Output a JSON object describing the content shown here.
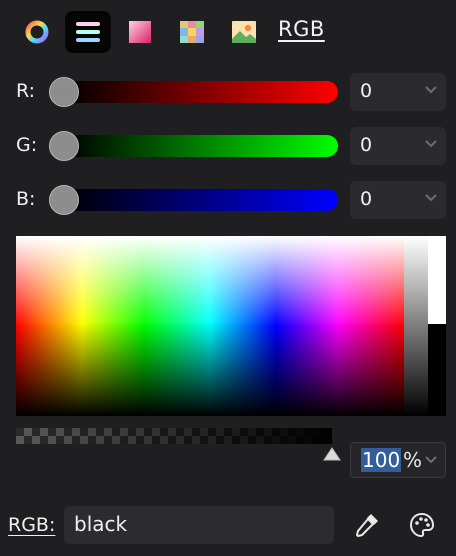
{
  "toolbar": {
    "tabs": [
      {
        "name": "color-wheel",
        "active": false
      },
      {
        "name": "sliders",
        "active": true
      },
      {
        "name": "color-palettes",
        "active": false
      },
      {
        "name": "color-swatches",
        "active": false
      },
      {
        "name": "image-colors",
        "active": false
      }
    ],
    "mode_label": "RGB"
  },
  "channels": [
    {
      "label": "R:",
      "value": "0",
      "color": "#ff0000"
    },
    {
      "label": "G:",
      "value": "0",
      "color": "#00ff00"
    },
    {
      "label": "B:",
      "value": "0",
      "color": "#0000ff"
    }
  ],
  "alpha": {
    "value": "100",
    "unit": "%"
  },
  "color_name": {
    "label": "RGB:",
    "value": "black"
  },
  "colors": {
    "background": "#1f1f21",
    "spin_box": "#2b2b2e",
    "selection": "#335e9a"
  },
  "icons": {
    "eyedropper": "eyedropper-icon",
    "palette": "palette-icon"
  }
}
